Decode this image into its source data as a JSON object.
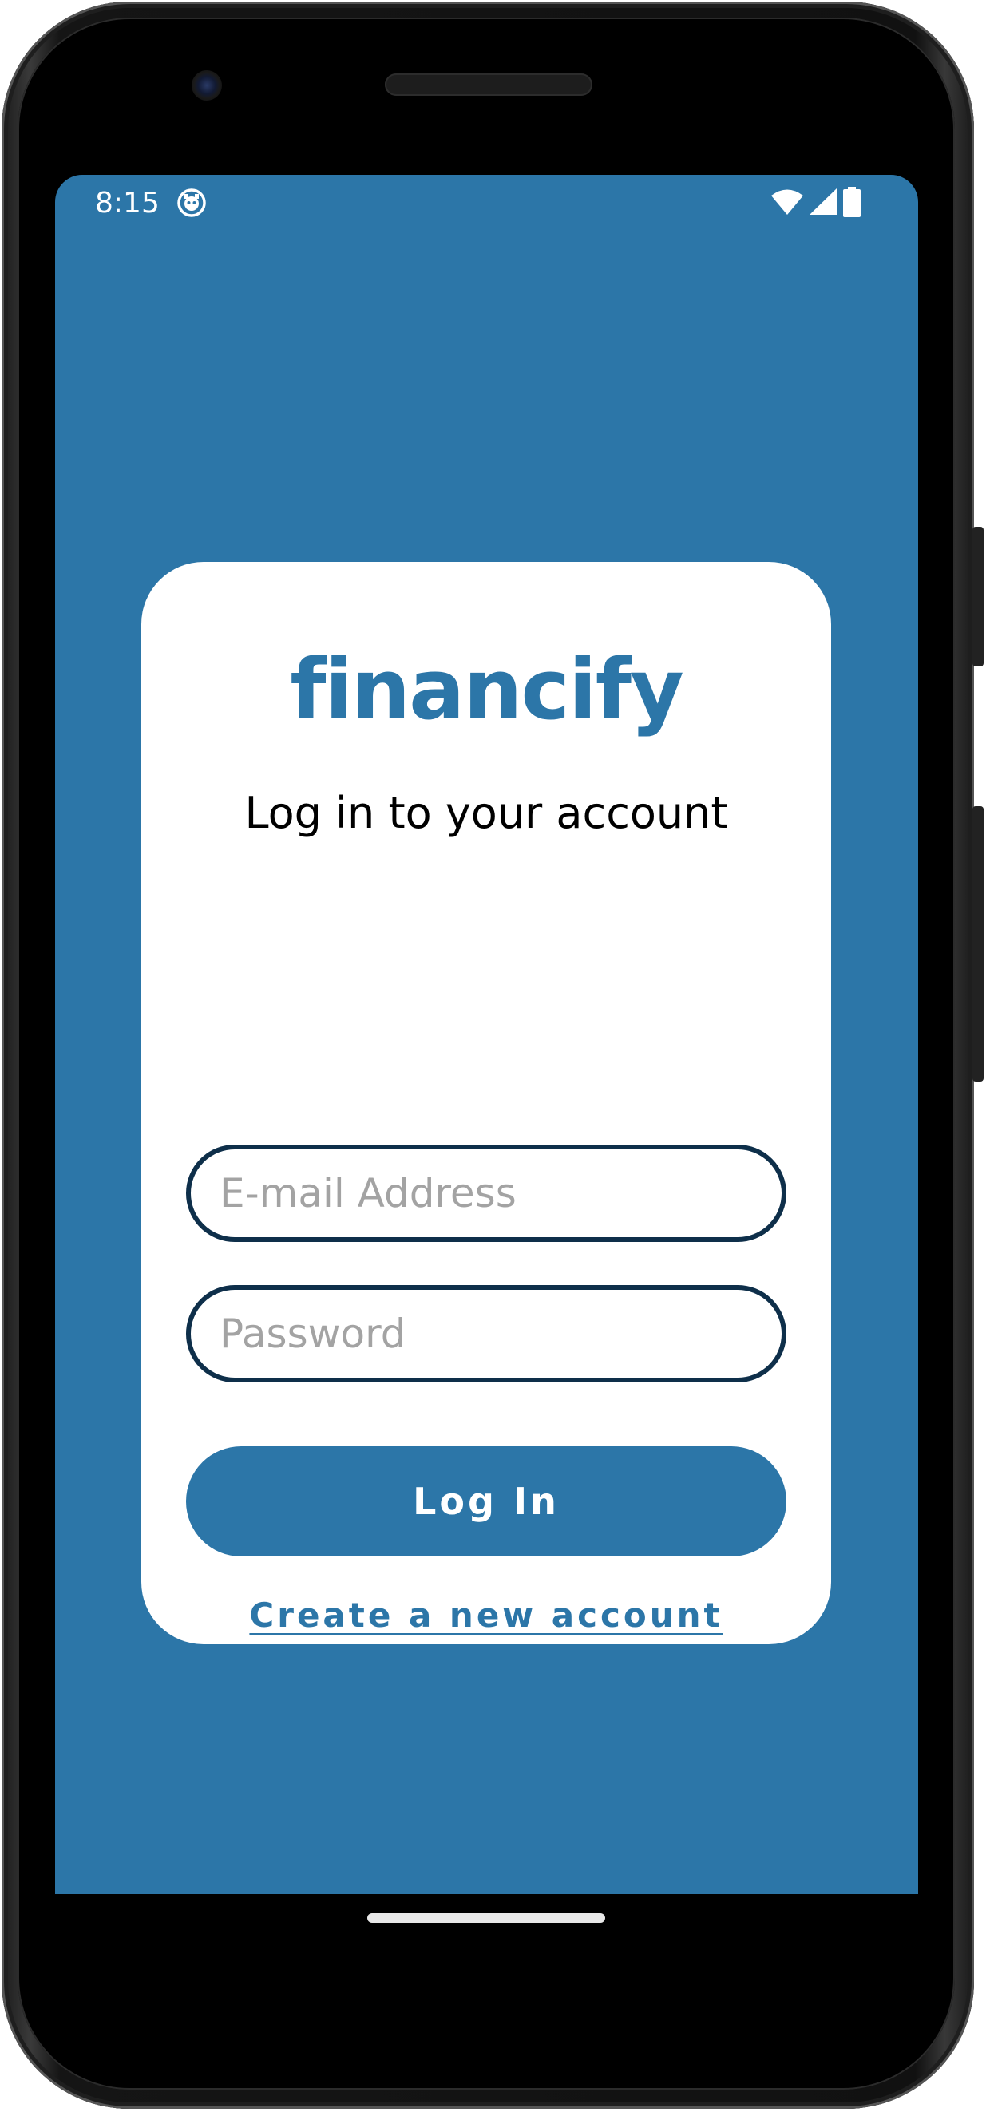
{
  "status_bar": {
    "time": "8:15",
    "icons": [
      "app-notification-icon",
      "wifi-icon",
      "cellular-signal-icon",
      "battery-icon"
    ]
  },
  "login": {
    "brand": "financify",
    "subtitle": "Log in to your account",
    "email_placeholder": "E-mail Address",
    "password_placeholder": "Password",
    "login_button": "Log In",
    "create_account_link": "Create a new account"
  },
  "colors": {
    "screen_background": "#2c76a8",
    "brand": "#2c76a8",
    "field_border": "#0e2f4a",
    "placeholder": "#a3a3a3",
    "card": "#ffffff"
  }
}
